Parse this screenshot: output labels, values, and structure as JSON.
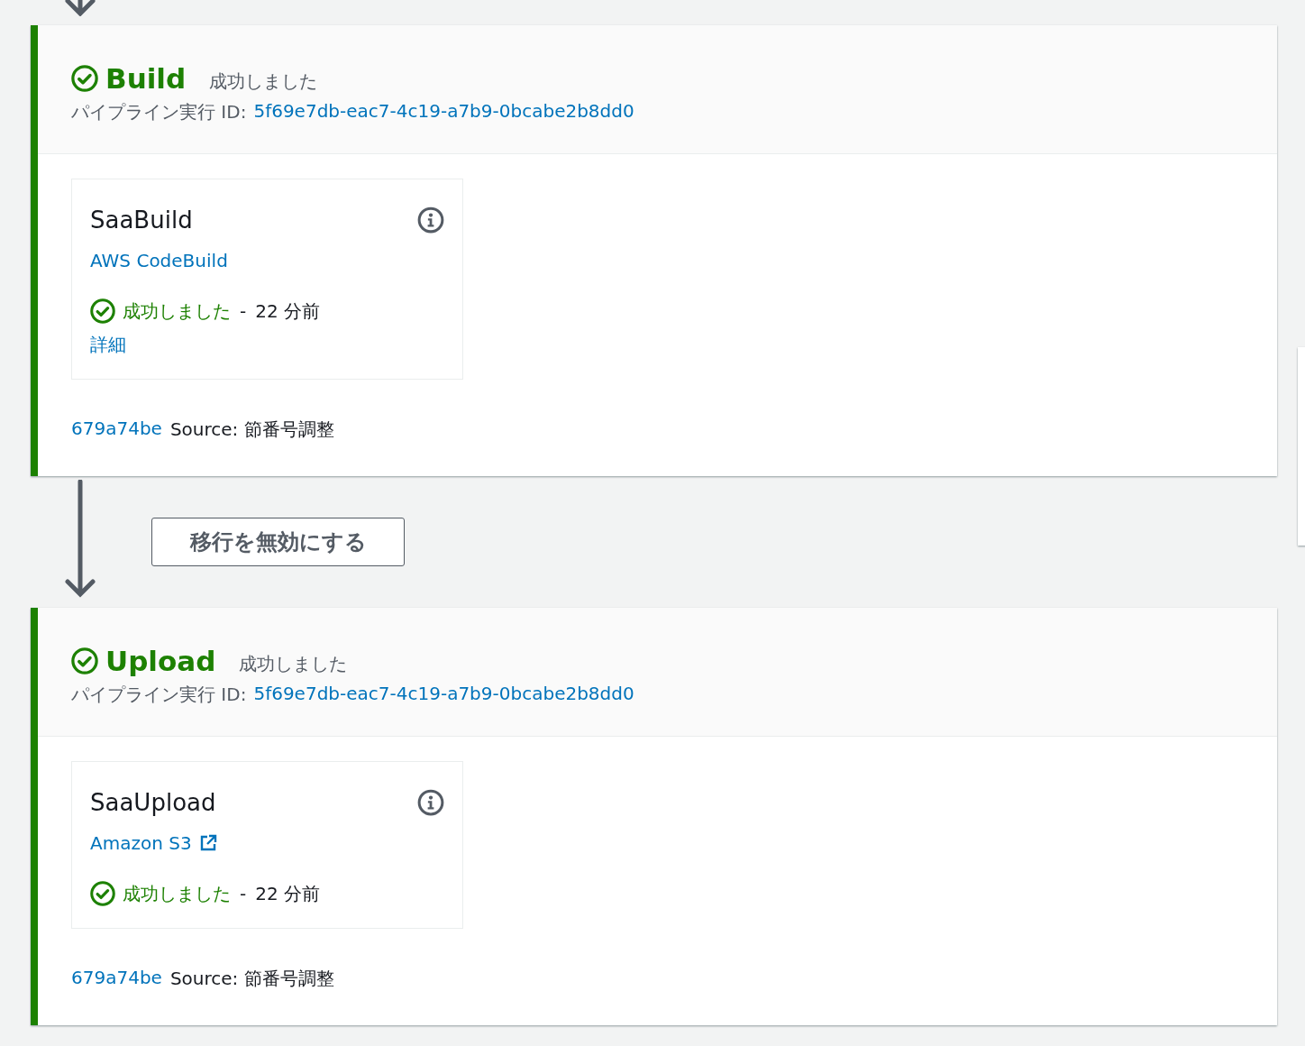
{
  "top_connector": {
    "kind": "arrow"
  },
  "stages": [
    {
      "name": "Build",
      "status": "成功しました",
      "kind": "succeeded",
      "execution_label": "パイプライン実行 ID:",
      "execution_id": "5f69e7db-eac7-4c19-a7b9-0bcabe2b8dd0",
      "actions": [
        {
          "name": "SaaBuild",
          "provider": "AWS CodeBuild",
          "external": false,
          "status": "成功しました",
          "kind": "succeeded",
          "separator": "-",
          "time": "22 分前",
          "details": "詳細"
        }
      ],
      "commit": {
        "id": "679a74be",
        "message": "Source: 節番号調整"
      },
      "transition": {
        "button": "移行を無効にする"
      }
    },
    {
      "name": "Upload",
      "status": "成功しました",
      "kind": "succeeded",
      "execution_label": "パイプライン実行 ID:",
      "execution_id": "5f69e7db-eac7-4c19-a7b9-0bcabe2b8dd0",
      "actions": [
        {
          "name": "SaaUpload",
          "provider": "Amazon S3",
          "external": true,
          "status": "成功しました",
          "kind": "succeeded",
          "separator": "-",
          "time": "22 分前"
        }
      ],
      "commit": {
        "id": "679a74be",
        "message": "Source: 節番号調整"
      }
    }
  ]
}
